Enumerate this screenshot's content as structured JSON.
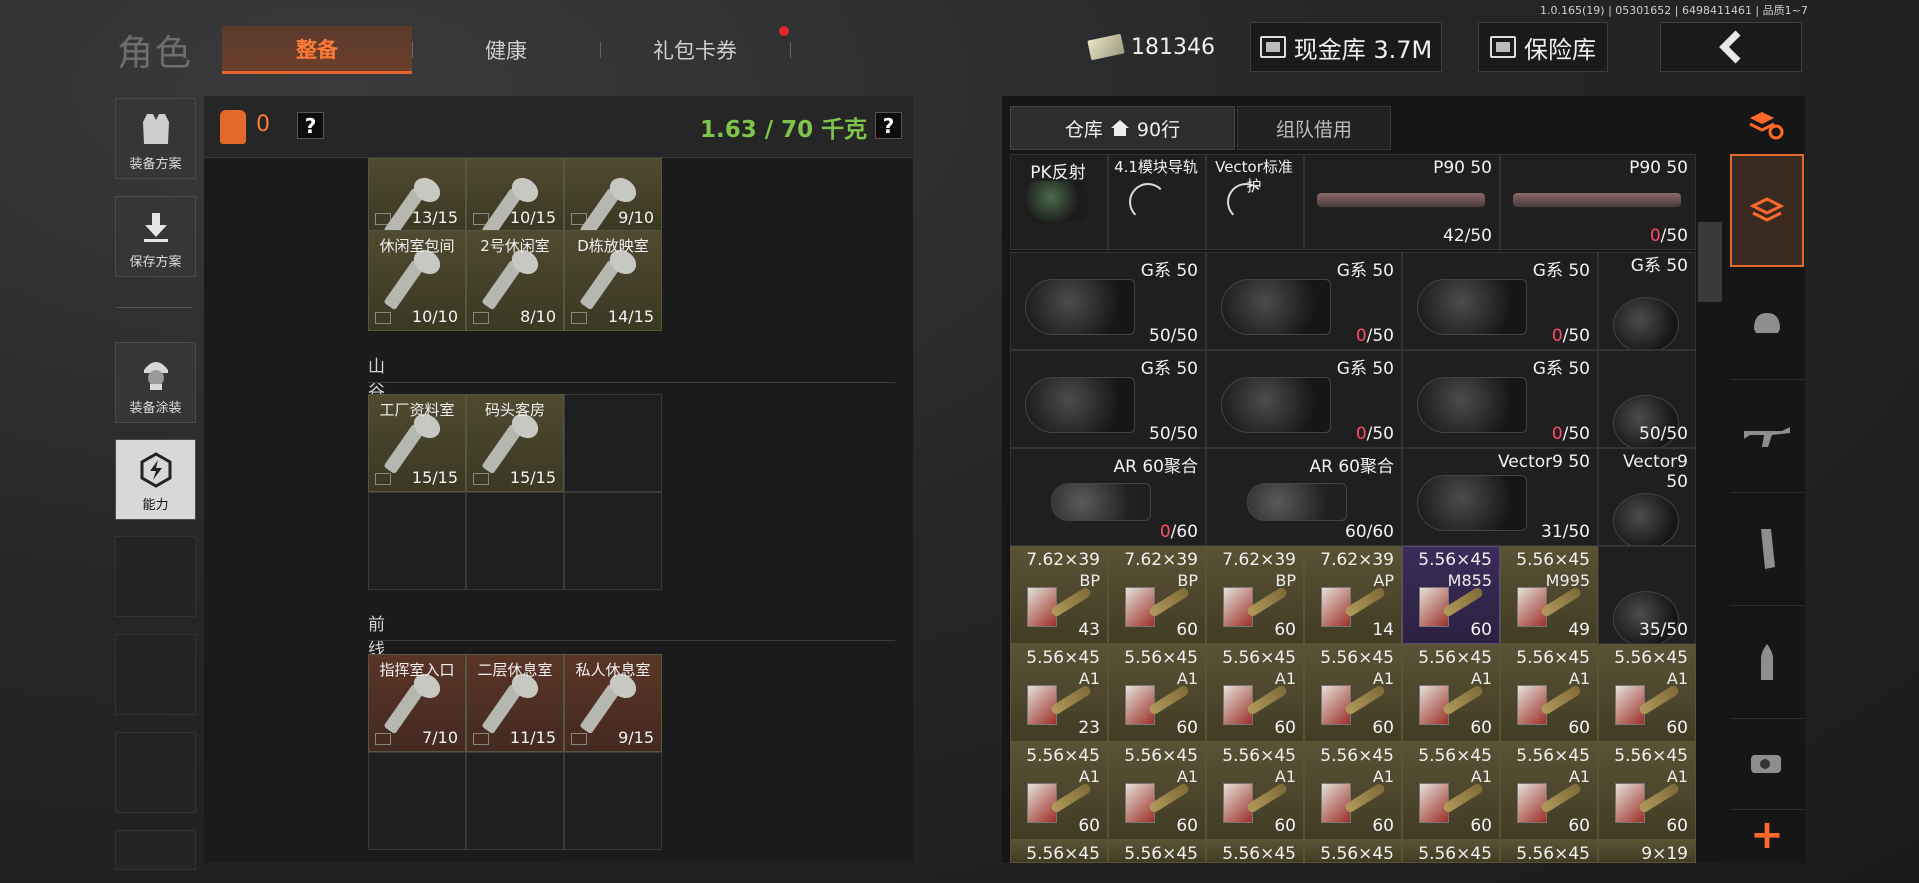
{
  "version": "1.0.165(19) | 05301652 | 6498411461 | 品质1~7",
  "title": "角色",
  "tabs": [
    {
      "label": "整备"
    },
    {
      "label": "健康"
    },
    {
      "label": "礼包卡券"
    }
  ],
  "top": {
    "money": "181346",
    "cash_vault": "现金库 3.7M",
    "safe_vault": "保险库",
    "back_icon": "chevron-left-icon"
  },
  "sidebar": [
    {
      "label": "装备方案",
      "icon": "vest-icon"
    },
    {
      "label": "保存方案",
      "icon": "download-icon"
    },
    {
      "label": "装备涂装",
      "icon": "helmet-soldier-icon"
    },
    {
      "label": "能力",
      "icon": "lightning-hex-icon"
    }
  ],
  "left_panel": {
    "backpack_count": "0",
    "help": "?",
    "weight": "1.63 / 70 千克",
    "sections": [
      {
        "title": "",
        "items": [
          {
            "name": "",
            "count": "13/15"
          },
          {
            "name": "",
            "count": "10/15"
          },
          {
            "name": "",
            "count": "9/10"
          },
          {
            "name": "休闲室包间",
            "count": "10/10"
          },
          {
            "name": "2号休闲室",
            "count": "8/10"
          },
          {
            "name": "D栋放映室",
            "count": "14/15"
          }
        ]
      },
      {
        "title": "山谷",
        "items": [
          {
            "name": "工厂资料室",
            "count": "15/15"
          },
          {
            "name": "码头客房",
            "count": "15/15"
          }
        ]
      },
      {
        "title": "前线要塞",
        "items": [
          {
            "name": "指挥室入口",
            "count": "7/10"
          },
          {
            "name": "二层休息室",
            "count": "11/15"
          },
          {
            "name": "私人休息室",
            "count": "9/15"
          }
        ]
      }
    ]
  },
  "warehouse": {
    "tab_warehouse": "仓库",
    "tab_rows": "90行",
    "tab_team": "组队借用",
    "rows": [
      [
        {
          "name": "PK反射",
          "count": "",
          "kind": "sight"
        },
        {
          "name": "4.1模块导轨",
          "count": "",
          "kind": "spin"
        },
        {
          "name": "Vector标准护",
          "count": "",
          "kind": "spin"
        },
        {
          "name": "P90 50",
          "count": "42/50",
          "kind": "pmag",
          "wide": true
        },
        {
          "name": "P90 50",
          "count": "0/50",
          "kind": "pmag",
          "wide": true,
          "zero": true
        }
      ],
      [
        {
          "name": "G系 50",
          "count": "50/50",
          "kind": "drum",
          "wide": true
        },
        {
          "name": "G系 50",
          "count": "0/50",
          "kind": "drum",
          "wide": true,
          "zero": true
        },
        {
          "name": "G系 50",
          "count": "0/50",
          "kind": "drum",
          "wide": true,
          "zero": true
        },
        {
          "name": "G系 50",
          "count": "",
          "kind": "drum"
        }
      ],
      [
        {
          "name": "G系 50",
          "count": "50/50",
          "kind": "drum",
          "wide": true
        },
        {
          "name": "G系 50",
          "count": "0/50",
          "kind": "drum",
          "wide": true,
          "zero": true
        },
        {
          "name": "G系 50",
          "count": "0/50",
          "kind": "drum",
          "wide": true,
          "zero": true
        },
        {
          "name": "",
          "count": "50/50",
          "kind": "drum"
        }
      ],
      [
        {
          "name": "AR 60聚合",
          "count": "0/60",
          "kind": "mag",
          "wide": true,
          "zero": true
        },
        {
          "name": "AR 60聚合",
          "count": "60/60",
          "kind": "mag",
          "wide": true
        },
        {
          "name": "Vector9 50",
          "count": "31/50",
          "kind": "drum",
          "wide": true
        },
        {
          "name": "Vector9 50",
          "count": "",
          "kind": "drum"
        }
      ],
      [
        {
          "name": "7.62×39",
          "sub": "BP",
          "count": "43",
          "kind": "ammo"
        },
        {
          "name": "7.62×39",
          "sub": "BP",
          "count": "60",
          "kind": "ammo"
        },
        {
          "name": "7.62×39",
          "sub": "BP",
          "count": "60",
          "kind": "ammo"
        },
        {
          "name": "7.62×39",
          "sub": "AP",
          "count": "14",
          "kind": "ammo"
        },
        {
          "name": "5.56×45",
          "sub": "M855",
          "count": "60",
          "kind": "ammo",
          "purple": true
        },
        {
          "name": "5.56×45",
          "sub": "M995",
          "count": "49",
          "kind": "ammo"
        },
        {
          "name": "",
          "count": "35/50",
          "kind": "drum"
        }
      ],
      [
        {
          "name": "5.56×45",
          "sub": "A1",
          "count": "23",
          "kind": "ammo"
        },
        {
          "name": "5.56×45",
          "sub": "A1",
          "count": "60",
          "kind": "ammo"
        },
        {
          "name": "5.56×45",
          "sub": "A1",
          "count": "60",
          "kind": "ammo"
        },
        {
          "name": "5.56×45",
          "sub": "A1",
          "count": "60",
          "kind": "ammo"
        },
        {
          "name": "5.56×45",
          "sub": "A1",
          "count": "60",
          "kind": "ammo"
        },
        {
          "name": "5.56×45",
          "sub": "A1",
          "count": "60",
          "kind": "ammo"
        },
        {
          "name": "5.56×45",
          "sub": "A1",
          "count": "60",
          "kind": "ammo"
        }
      ],
      [
        {
          "name": "5.56×45",
          "sub": "A1",
          "count": "60",
          "kind": "ammo"
        },
        {
          "name": "5.56×45",
          "sub": "A1",
          "count": "60",
          "kind": "ammo"
        },
        {
          "name": "5.56×45",
          "sub": "A1",
          "count": "60",
          "kind": "ammo"
        },
        {
          "name": "5.56×45",
          "sub": "A1",
          "count": "60",
          "kind": "ammo"
        },
        {
          "name": "5.56×45",
          "sub": "A1",
          "count": "60",
          "kind": "ammo"
        },
        {
          "name": "5.56×45",
          "sub": "A1",
          "count": "60",
          "kind": "ammo"
        },
        {
          "name": "5.56×45",
          "sub": "A1",
          "count": "60",
          "kind": "ammo"
        }
      ],
      [
        {
          "name": "5.56×45",
          "count": "",
          "kind": "ammo"
        },
        {
          "name": "5.56×45",
          "count": "",
          "kind": "ammo"
        },
        {
          "name": "5.56×45",
          "count": "",
          "kind": "ammo"
        },
        {
          "name": "5.56×45",
          "count": "",
          "kind": "ammo"
        },
        {
          "name": "5.56×45",
          "count": "",
          "kind": "ammo"
        },
        {
          "name": "5.56×45",
          "count": "",
          "kind": "ammo"
        },
        {
          "name": "9×19",
          "count": "",
          "kind": "ammo"
        }
      ]
    ]
  },
  "category_filters": [
    {
      "icon": "stack-refresh-icon"
    },
    {
      "icon": "stack-icon"
    },
    {
      "icon": "helmet-icon"
    },
    {
      "icon": "rifle-icon"
    },
    {
      "icon": "magazine-icon"
    },
    {
      "icon": "bullet-icon"
    },
    {
      "icon": "red-dot-sight-icon"
    }
  ],
  "add_label": "+",
  "colors": {
    "accent": "#e36a2a",
    "weight": "#7fc34b",
    "zero": "#ff4b6a"
  }
}
